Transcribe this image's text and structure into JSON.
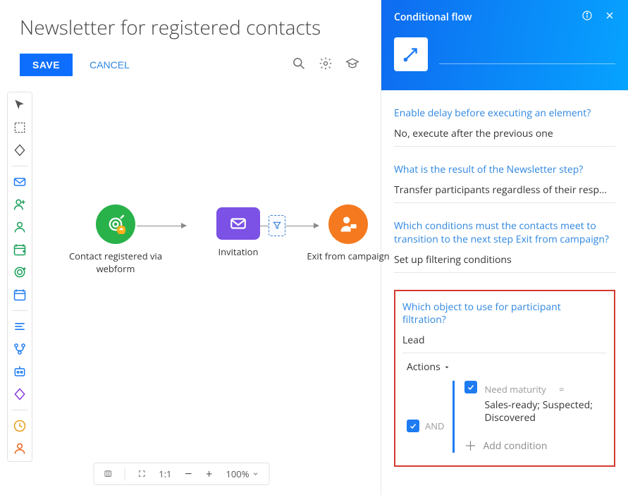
{
  "page_title": "Newsletter for registered contacts",
  "toolbar": {
    "save_label": "SAVE",
    "cancel_label": "CANCEL"
  },
  "diagram": {
    "node_webform": "Contact registered via webform",
    "node_invitation": "Invitation",
    "node_exit": "Exit from campaign"
  },
  "zoom": {
    "ratio_label": "1:1",
    "value_label": "100%"
  },
  "panel": {
    "header_title": "Conditional flow",
    "element_name": "",
    "q_delay_label": "Enable delay before executing an element?",
    "q_delay_value": "No, execute after the previous one",
    "q_result_label": "What is the result of the Newsletter step?",
    "q_result_value": "Transfer participants regardless of their resp...",
    "q_cond_label": "Which conditions must the contacts meet to transition to the next step Exit from campaign?",
    "q_cond_value": "Set up filtering conditions",
    "q_object_label": "Which object to use for participant filtration?",
    "q_object_value": "Lead",
    "actions_label": "Actions",
    "logic_op": "AND",
    "cond_field": "Need maturity",
    "cond_op": "=",
    "cond_value": "Sales-ready; Suspected; Discovered",
    "add_condition_label": "Add condition"
  }
}
